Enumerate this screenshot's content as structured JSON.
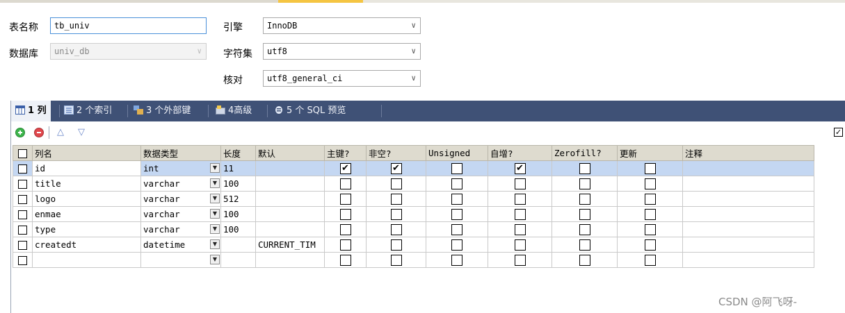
{
  "form": {
    "table_name_label": "表名称",
    "table_name_value": "tb_univ",
    "database_label": "数据库",
    "database_value": "univ_db",
    "engine_label": "引擎",
    "engine_value": "InnoDB",
    "charset_label": "字符集",
    "charset_value": "utf8",
    "collation_label": "核对",
    "collation_value": "utf8_general_ci"
  },
  "tabs": [
    {
      "label": "1 列"
    },
    {
      "label": "2 个索引"
    },
    {
      "label": "3 个外部键"
    },
    {
      "label": "4高级"
    },
    {
      "label": "5 个 SQL 预览"
    }
  ],
  "toolbar": {
    "add_icon": "plus-circle-icon",
    "delete_icon": "minus-circle-icon",
    "up_symbol": "△",
    "down_symbol": "▽",
    "corner_check": "☑"
  },
  "columns_header": [
    "列名",
    "数据类型",
    "长度",
    "默认",
    "主键?",
    "非空?",
    "Unsigned",
    "自增?",
    "Zerofill?",
    "更新",
    "注释"
  ],
  "rows": [
    {
      "name": "id",
      "type": "int",
      "length": "11",
      "default": "",
      "pk": "✔",
      "notnull": "✔",
      "unsigned": "",
      "autoinc": "✔",
      "zerofill": "",
      "update": "",
      "comment": ""
    },
    {
      "name": "title",
      "type": "varchar",
      "length": "100",
      "default": "",
      "pk": "",
      "notnull": "",
      "unsigned": "",
      "autoinc": "",
      "zerofill": "",
      "update": "",
      "comment": ""
    },
    {
      "name": "logo",
      "type": "varchar",
      "length": "512",
      "default": "",
      "pk": "",
      "notnull": "",
      "unsigned": "",
      "autoinc": "",
      "zerofill": "",
      "update": "",
      "comment": ""
    },
    {
      "name": "enmae",
      "type": "varchar",
      "length": "100",
      "default": "",
      "pk": "",
      "notnull": "",
      "unsigned": "",
      "autoinc": "",
      "zerofill": "",
      "update": "",
      "comment": ""
    },
    {
      "name": "type",
      "type": "varchar",
      "length": "100",
      "default": "",
      "pk": "",
      "notnull": "",
      "unsigned": "",
      "autoinc": "",
      "zerofill": "",
      "update": "",
      "comment": ""
    },
    {
      "name": "createdt",
      "type": "datetime",
      "length": "",
      "default": "CURRENT_TIM",
      "pk": "",
      "notnull": "",
      "unsigned": "",
      "autoinc": "",
      "zerofill": "",
      "update": "",
      "comment": ""
    },
    {
      "name": "",
      "type": "",
      "length": "",
      "default": "",
      "pk": "",
      "notnull": "",
      "unsigned": "",
      "autoinc": "",
      "zerofill": "",
      "update": "",
      "comment": ""
    }
  ],
  "watermark": "CSDN @阿飞呀-"
}
